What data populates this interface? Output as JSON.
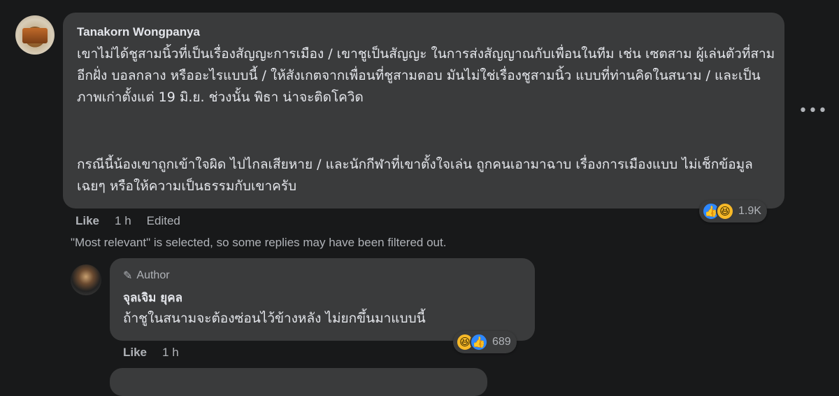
{
  "comment": {
    "author": "Tanakorn Wongpanya",
    "paragraphs": [
      "เขาไม่ได้ชูสามนิ้วที่เป็นเรื่องสัญญะการเมือง / เขาชูเป็นสัญญะ ในการส่งสัญญาณกับเพื่อนในทีม เช่น เซตสาม ผู้เล่นตัวที่สามอีกฝั่ง บอลกลาง หรืออะไรแบบนี้ / ให้สังเกตจากเพื่อนที่ชูสามตอบ มันไม่ใช่เรื่องชูสามนิ้ว แบบที่ท่านคิดในสนาม / และเป็นภาพเก่าตั้งแต่ 19 มิ.ย. ช่วงนั้น พิธา น่าจะติดโควิด",
      "กรณีนี้น้องเขาถูกเข้าใจผิด ไปไกลเสียหาย / และนักกีฬาที่เขาตั้งใจเล่น ถูกคนเอามาฉาบ เรื่องการเมืองแบบ ไม่เช็กข้อมูลเฉยๆ หรือให้ความเป็นธรรมกับเขาครับ"
    ],
    "reaction_count": "1.9K",
    "like_label": "Like",
    "time": "1 h",
    "edited_label": "Edited",
    "more_icon": "more-options-icon"
  },
  "filter_note": "\"Most relevant\" is selected, so some replies may have been filtered out.",
  "reply": {
    "badge": "Author",
    "author": "จุลเจิม ยุคล",
    "text": "ถ้าชูในสนามจะต้องซ่อนไว้ข้างหลัง ไม่ยกขึ้นมาแบบนี้",
    "reaction_count": "689",
    "like_label": "Like",
    "time": "1 h"
  },
  "colors": {
    "background": "#18191a",
    "bubble": "#3a3b3c",
    "text": "#e4e6eb",
    "secondary_text": "#b0b3b8",
    "like_blue": "#2d88ff",
    "haha_yellow": "#f7b928"
  }
}
